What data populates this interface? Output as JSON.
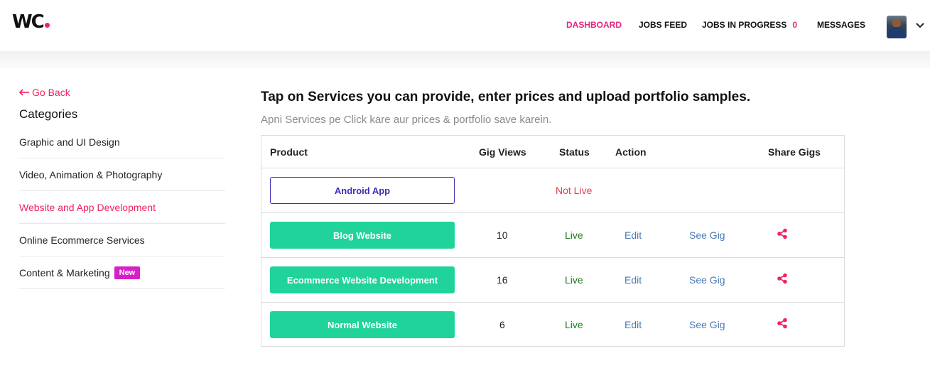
{
  "header": {
    "logo_text": "WC",
    "nav": [
      {
        "label": "DASHBOARD",
        "active": true
      },
      {
        "label": "JOBS FEED",
        "active": false
      },
      {
        "label": "JOBS IN PROGRESS",
        "count": "0",
        "active": false
      },
      {
        "label": "MESSAGES",
        "active": false
      }
    ],
    "avatar_icon": "user-avatar",
    "dropdown_icon": "chevron-down-icon"
  },
  "sidebar": {
    "back_label": "Go Back",
    "title": "Categories",
    "items": [
      {
        "label": "Graphic and UI Design",
        "active": false
      },
      {
        "label": "Video, Animation & Photography",
        "active": false
      },
      {
        "label": "Website and App Development",
        "active": true
      },
      {
        "label": "Online Ecommerce Services",
        "active": false
      },
      {
        "label": "Content & Marketing",
        "active": false,
        "badge": "New"
      }
    ]
  },
  "main": {
    "title": "Tap on Services you can provide, enter prices and upload portfolio samples.",
    "subtitle": "Apni Services pe Click kare aur prices & portfolio save karein.",
    "table": {
      "headers": {
        "product": "Product",
        "gig_views": "Gig Views",
        "status": "Status",
        "action": "Action",
        "share": "Share Gigs"
      },
      "rows": [
        {
          "product": "Android App",
          "views": "",
          "status": "Not Live",
          "edit": "",
          "see_gig": ""
        },
        {
          "product": "Blog Website",
          "views": "10",
          "status": "Live",
          "edit": "Edit",
          "see_gig": "See Gig"
        },
        {
          "product": "Ecommerce Website Development",
          "views": "16",
          "status": "Live",
          "edit": "Edit",
          "see_gig": "See Gig"
        },
        {
          "product": "Normal Website",
          "views": "6",
          "status": "Live",
          "edit": "Edit",
          "see_gig": "See Gig"
        }
      ]
    }
  },
  "colors": {
    "accent_pink": "#e6247f",
    "brand_red": "#f0245e",
    "button_green": "#1fd39b",
    "outline_purple": "#3b2fb8",
    "badge_magenta": "#d820c8",
    "live_green": "#1d7d1d",
    "not_live_red": "#e53b50",
    "link_blue": "#4a7bb5"
  }
}
